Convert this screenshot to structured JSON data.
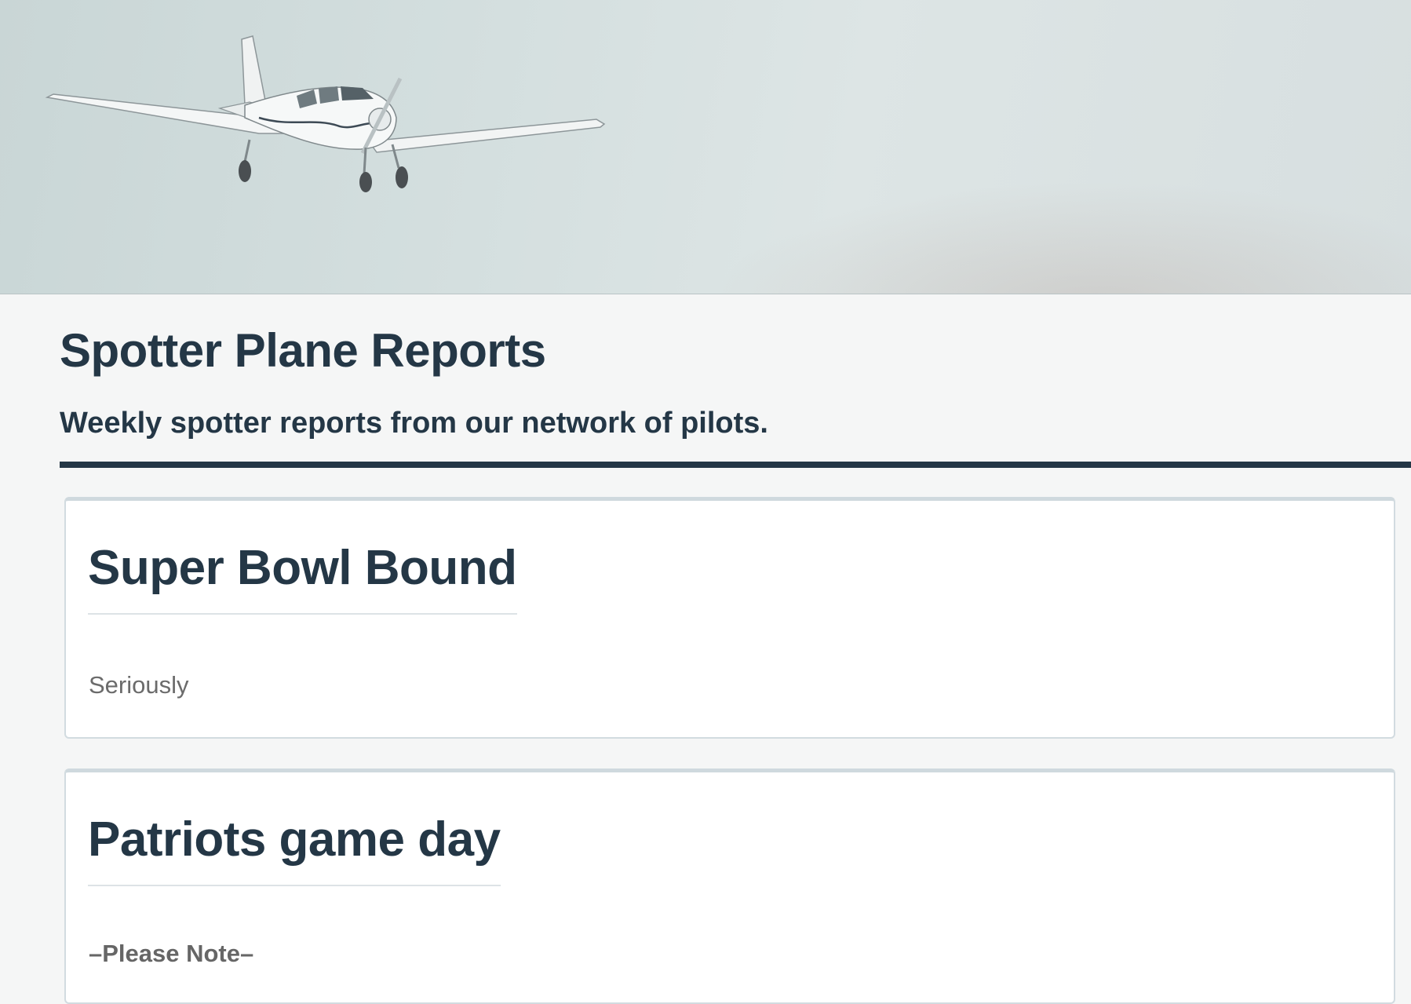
{
  "hero": {
    "image": "small-airplane-in-flight"
  },
  "header": {
    "title": "Spotter Plane Reports",
    "subtitle": "Weekly spotter reports from our network of pilots."
  },
  "posts": [
    {
      "title": "Super Bowl Bound",
      "body": "Seriously"
    },
    {
      "title": "Patriots game day",
      "body": "–Please Note–"
    }
  ],
  "colors": {
    "heading": "#243746",
    "background": "#f5f6f6",
    "card": "#ffffff",
    "card_border": "#d2dbe0"
  }
}
